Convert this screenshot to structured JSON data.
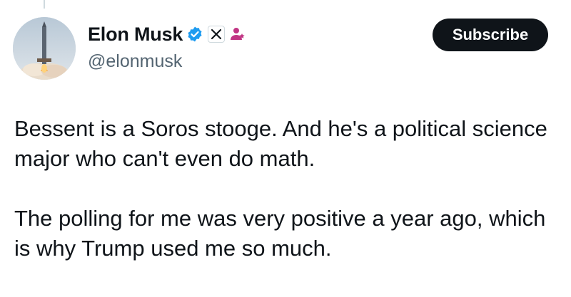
{
  "author": {
    "display_name": "Elon Musk",
    "handle": "@elonmusk",
    "avatar_icon": "rocket-launch-avatar",
    "verified_icon": "verified-badge-icon",
    "affiliation_icon": "x-logo-icon",
    "extra_icon": "affiliate-person-icon"
  },
  "actions": {
    "subscribe_label": "Subscribe"
  },
  "tweet": {
    "paragraphs": [
      "Bessent is a Soros stooge. And he's a political science major who can't even do math.",
      "The polling for me was very positive a year ago, which is why Trump used me so much."
    ]
  },
  "colors": {
    "text": "#0f1419",
    "secondary": "#536471",
    "verified": "#1d9bf0",
    "affiliate": "#c13584",
    "button_bg": "#0f1419"
  }
}
